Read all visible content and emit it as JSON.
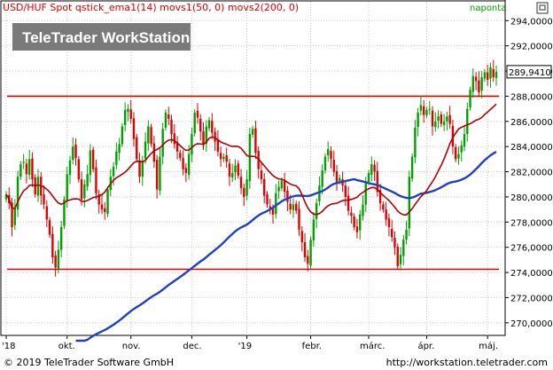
{
  "header": {
    "instrument": "USD/HUF Spot",
    "indicators": "qstick_ema1(14) movs1(50, 0) movs2(200, 0)",
    "period": "naponta"
  },
  "watermark": "TeleTrader WorkStation",
  "footer": {
    "copyright": "© 2019 TeleTrader Software GmbH",
    "url": "http://workstation.teletrader.com"
  },
  "colors": {
    "up": "#00a000",
    "down": "#e00000",
    "ma50": "#b00000",
    "ma200": "#2040c0",
    "hline": "#e00000",
    "header_text": "#e00000",
    "period_text": "#00a000"
  },
  "chart_data": {
    "type": "candlestick",
    "y_ticks": [
      "294,0000",
      "292,0000",
      "290,0000",
      "288,0000",
      "286,0000",
      "284,0000",
      "282,0000",
      "280,0000",
      "278,0000",
      "276,0000",
      "274,0000",
      "272,0000",
      "270,0000"
    ],
    "ylim": [
      269.0,
      295.5
    ],
    "last_price": 289.941,
    "last_price_label": "289,9410",
    "horizontal_lines": [
      288.0,
      274.25
    ],
    "x_ticks": [
      {
        "label": "'18",
        "i": 0
      },
      {
        "label": "okt.",
        "i": 21
      },
      {
        "label": "nov.",
        "i": 43
      },
      {
        "label": "dec.",
        "i": 64
      },
      {
        "label": "'19",
        "i": 83
      },
      {
        "label": "febr.",
        "i": 105
      },
      {
        "label": "márc.",
        "i": 125
      },
      {
        "label": "ápr.",
        "i": 145
      },
      {
        "label": "máj.",
        "i": 166
      }
    ],
    "closes": [
      280.2,
      279.5,
      277.6,
      279.1,
      281.6,
      282.6,
      282.8,
      281.8,
      283.0,
      281.4,
      280.2,
      281.6,
      280.1,
      279.4,
      278.2,
      277.0,
      275.2,
      274.4,
      275.8,
      277.6,
      279.8,
      281.8,
      282.9,
      284.0,
      283.1,
      281.4,
      279.8,
      281.0,
      281.8,
      283.7,
      282.2,
      280.3,
      279.4,
      279.0,
      278.8,
      280.6,
      281.6,
      282.4,
      283.6,
      284.2,
      285.6,
      286.9,
      287.0,
      286.2,
      284.6,
      283.0,
      281.6,
      282.9,
      284.4,
      285.6,
      284.2,
      282.8,
      280.6,
      283.2,
      285.4,
      286.7,
      286.2,
      285.0,
      284.2,
      283.6,
      283.1,
      282.2,
      281.9,
      283.4,
      285.0,
      286.7,
      286.3,
      285.2,
      284.1,
      285.6,
      286.1,
      285.1,
      284.4,
      283.6,
      283.0,
      283.2,
      282.8,
      281.6,
      281.9,
      282.5,
      281.7,
      280.7,
      280.0,
      281.4,
      285.0,
      285.4,
      283.5,
      282.2,
      281.4,
      280.1,
      279.4,
      279.1,
      278.6,
      280.3,
      280.8,
      281.3,
      280.4,
      279.6,
      279.0,
      279.4,
      278.9,
      277.4,
      276.4,
      275.2,
      274.7,
      276.6,
      278.2,
      279.5,
      280.9,
      282.1,
      283.2,
      283.8,
      283.0,
      282.0,
      281.1,
      281.5,
      280.9,
      280.0,
      278.9,
      278.5,
      277.6,
      277.2,
      278.6,
      279.4,
      281.1,
      281.9,
      282.6,
      282.0,
      280.4,
      279.5,
      279.0,
      278.2,
      277.6,
      276.8,
      276.0,
      274.5,
      275.4,
      276.6,
      277.4,
      281.6,
      283.2,
      285.5,
      286.7,
      287.3,
      286.5,
      286.9,
      287.0,
      285.6,
      286.0,
      286.4,
      285.8,
      286.0,
      286.4,
      285.8,
      284.0,
      283.0,
      283.4,
      284.1,
      285.0,
      287.0,
      288.5,
      289.6,
      289.2,
      288.3,
      289.5,
      289.9,
      289.3,
      290.3,
      289.5,
      289.94
    ]
  }
}
